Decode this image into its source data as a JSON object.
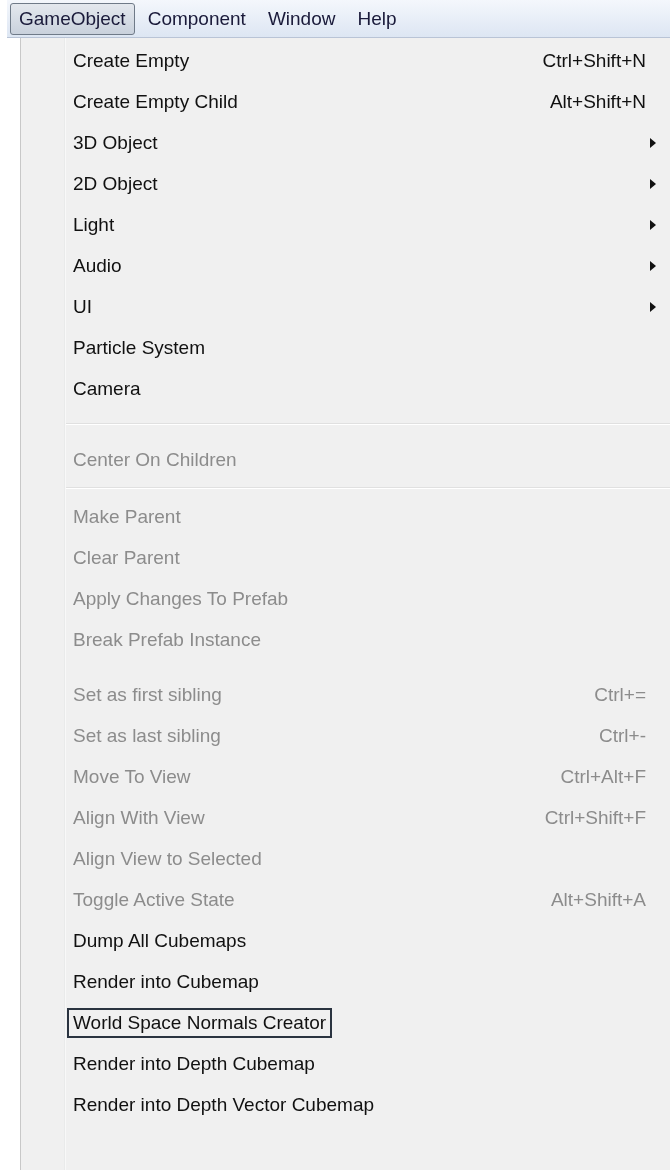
{
  "menubar": [
    {
      "label": "GameObject",
      "selected": true
    },
    {
      "label": "Component",
      "selected": false
    },
    {
      "label": "Window",
      "selected": false
    },
    {
      "label": "Help",
      "selected": false
    }
  ],
  "menu": {
    "items": [
      {
        "kind": "item",
        "label": "Create Empty",
        "shortcut": "Ctrl+Shift+N",
        "submenu": false,
        "disabled": false,
        "selected": false
      },
      {
        "kind": "item",
        "label": "Create Empty Child",
        "shortcut": "Alt+Shift+N",
        "submenu": false,
        "disabled": false,
        "selected": false
      },
      {
        "kind": "item",
        "label": "3D Object",
        "submenu": true,
        "disabled": false,
        "selected": false
      },
      {
        "kind": "item",
        "label": "2D Object",
        "submenu": true,
        "disabled": false,
        "selected": false
      },
      {
        "kind": "item",
        "label": "Light",
        "submenu": true,
        "disabled": false,
        "selected": false
      },
      {
        "kind": "item",
        "label": "Audio",
        "submenu": true,
        "disabled": false,
        "selected": false
      },
      {
        "kind": "item",
        "label": "UI",
        "submenu": true,
        "disabled": false,
        "selected": false
      },
      {
        "kind": "item",
        "label": "Particle System",
        "submenu": false,
        "disabled": false,
        "selected": false
      },
      {
        "kind": "item",
        "label": "Camera",
        "submenu": false,
        "disabled": false,
        "selected": false
      },
      {
        "kind": "separator"
      },
      {
        "kind": "item",
        "label": "Center On Children",
        "submenu": false,
        "disabled": true,
        "selected": false
      },
      {
        "kind": "separator"
      },
      {
        "kind": "item",
        "label": "Make Parent",
        "submenu": false,
        "disabled": true,
        "selected": false
      },
      {
        "kind": "item",
        "label": "Clear Parent",
        "submenu": false,
        "disabled": true,
        "selected": false
      },
      {
        "kind": "item",
        "label": "Apply Changes To Prefab",
        "submenu": false,
        "disabled": true,
        "selected": false
      },
      {
        "kind": "item",
        "label": "Break Prefab Instance",
        "submenu": false,
        "disabled": true,
        "selected": false
      },
      {
        "kind": "gap"
      },
      {
        "kind": "item",
        "label": "Set as first sibling",
        "shortcut": "Ctrl+=",
        "submenu": false,
        "disabled": true,
        "selected": false
      },
      {
        "kind": "item",
        "label": "Set as last sibling",
        "shortcut": "Ctrl+-",
        "submenu": false,
        "disabled": true,
        "selected": false
      },
      {
        "kind": "item",
        "label": "Move To View",
        "shortcut": "Ctrl+Alt+F",
        "submenu": false,
        "disabled": true,
        "selected": false
      },
      {
        "kind": "item",
        "label": "Align With View",
        "shortcut": "Ctrl+Shift+F",
        "submenu": false,
        "disabled": true,
        "selected": false
      },
      {
        "kind": "item",
        "label": "Align View to Selected",
        "submenu": false,
        "disabled": true,
        "selected": false
      },
      {
        "kind": "item",
        "label": "Toggle Active State",
        "shortcut": "Alt+Shift+A",
        "submenu": false,
        "disabled": true,
        "selected": false
      },
      {
        "kind": "item",
        "label": "Dump All Cubemaps",
        "submenu": false,
        "disabled": false,
        "selected": false
      },
      {
        "kind": "item",
        "label": "Render into Cubemap",
        "submenu": false,
        "disabled": false,
        "selected": false
      },
      {
        "kind": "item",
        "label": "World Space Normals Creator",
        "submenu": false,
        "disabled": false,
        "selected": true
      },
      {
        "kind": "item",
        "label": "Render into Depth Cubemap",
        "submenu": false,
        "disabled": false,
        "selected": false
      },
      {
        "kind": "item",
        "label": "Render into Depth Vector Cubemap",
        "submenu": false,
        "disabled": false,
        "selected": false
      }
    ]
  }
}
